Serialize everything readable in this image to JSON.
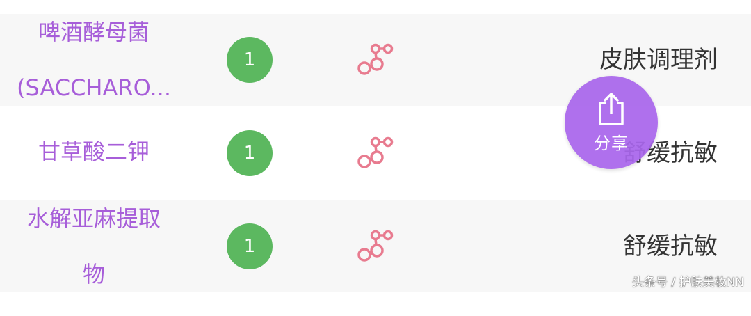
{
  "colors": {
    "name_text": "#a75ed9",
    "badge_green": "#5cb860",
    "molecule_pink": "#e87b8f",
    "fab_purple": "#a966ec",
    "row_shaded": "#f7f7f7"
  },
  "ingredients": [
    {
      "name_line1": "啤酒酵母菌",
      "name_line2": "(SACCHARO...",
      "safety_score": "1",
      "icon": "molecule-icon",
      "usage": "皮肤调理剂"
    },
    {
      "name_line1": "甘草酸二钾",
      "name_line2": "",
      "safety_score": "1",
      "icon": "molecule-icon",
      "usage": "舒缓抗敏"
    },
    {
      "name_line1": "水解亚麻提取",
      "name_line2": "物",
      "safety_score": "1",
      "icon": "molecule-icon",
      "usage": "舒缓抗敏"
    }
  ],
  "share_fab": {
    "icon": "share-upload-icon",
    "label": "分享"
  },
  "watermark": "头条号 / 护肤美妆NN"
}
